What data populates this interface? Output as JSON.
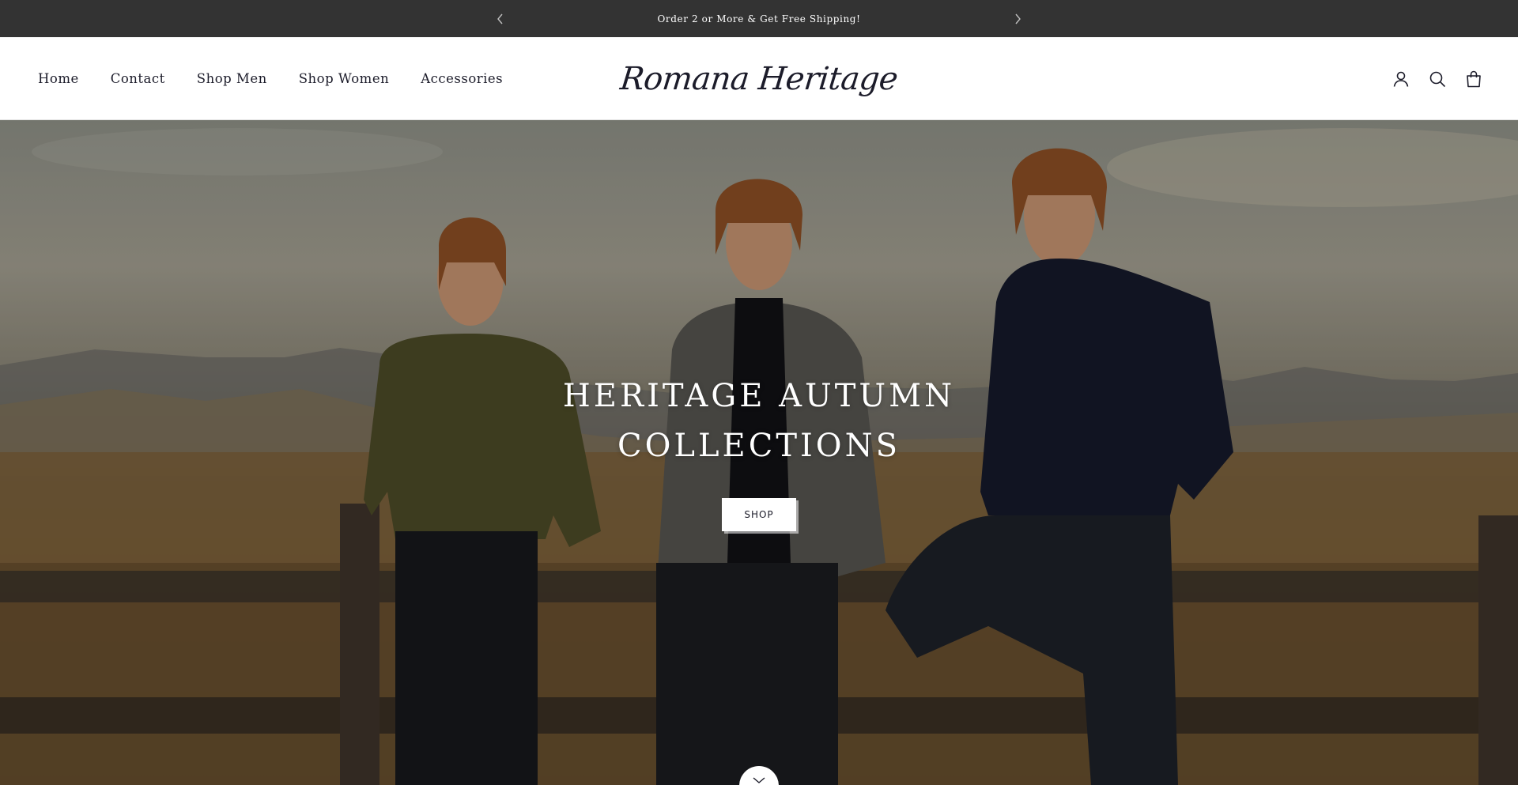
{
  "announcement": {
    "message": "Order 2 or More & Get Free Shipping!",
    "prev_icon": "chevron-left-icon",
    "next_icon": "chevron-right-icon"
  },
  "header": {
    "nav": [
      {
        "label": "Home"
      },
      {
        "label": "Contact"
      },
      {
        "label": "Shop Men"
      },
      {
        "label": "Shop Women"
      },
      {
        "label": "Accessories"
      }
    ],
    "logo": "Romana Heritage",
    "icons": [
      "account-icon",
      "search-icon",
      "cart-bag-icon"
    ]
  },
  "hero": {
    "title_line1": "HERITAGE AUTUMN",
    "title_line2": "COLLECTIONS",
    "button_label": "SHOP",
    "scroll_icon": "chevron-down-icon"
  },
  "colors": {
    "announcement_bg": "#333333",
    "text_dark": "#1c1c2a",
    "white": "#ffffff"
  }
}
